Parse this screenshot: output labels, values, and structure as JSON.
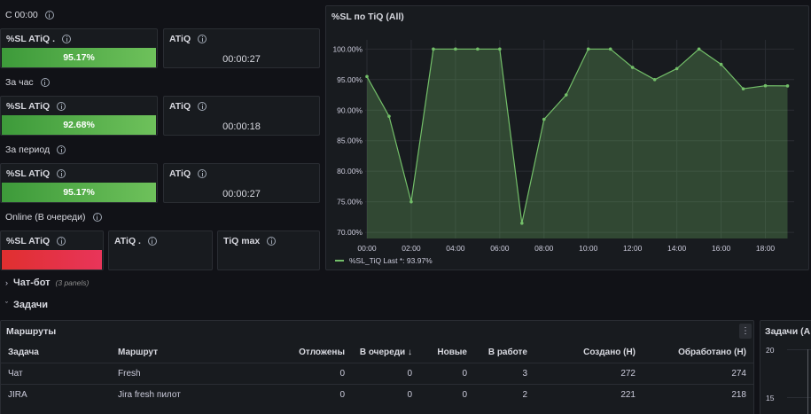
{
  "top": {
    "title_since": "С 00:00",
    "sl1": {
      "title": "%SL ATiQ .",
      "value": "95.17%"
    },
    "atiq1": {
      "title": "ATiQ",
      "value": "00:00:27"
    },
    "title_hour": "За час",
    "sl2": {
      "title": "%SL ATiQ",
      "value": "92.68%"
    },
    "atiq2": {
      "title": "ATiQ",
      "value": "00:00:18"
    },
    "title_period": "За период",
    "sl3": {
      "title": "%SL ATiQ",
      "value": "95.17%"
    },
    "atiq3": {
      "title": "ATiQ",
      "value": "00:00:27"
    },
    "title_online": "Online (В очереди)",
    "online_sl": {
      "title": "%SL ATiQ"
    },
    "online_atiq": {
      "title": "ATiQ ."
    },
    "online_tiq": {
      "title": "TiQ max"
    }
  },
  "colors": {
    "green": "#73bf69",
    "red": "#e02f44",
    "bg": "#111217",
    "panel": "#181b1f"
  },
  "chart_panel": {
    "title": "%SL по TiQ (All)",
    "legend": "%SL_TiQ  Last *: 93.97%"
  },
  "chart_data": {
    "type": "area",
    "title": "%SL по TiQ (All)",
    "x_ticks": [
      "00:00",
      "02:00",
      "04:00",
      "06:00",
      "08:00",
      "10:00",
      "12:00",
      "14:00",
      "16:00",
      "18:00"
    ],
    "y_ticks": [
      "70.00%",
      "75.00%",
      "80.00%",
      "85.00%",
      "90.00%",
      "95.00%",
      "100.00%"
    ],
    "ylim": [
      69,
      101.5
    ],
    "xlim": [
      0,
      19.3
    ],
    "series": [
      {
        "name": "%SL_TiQ",
        "color": "#73bf69",
        "x": [
          0,
          1,
          2,
          3,
          4,
          5,
          6,
          7,
          8,
          9,
          10,
          11,
          12,
          13,
          14,
          15,
          16,
          17,
          18,
          19
        ],
        "y": [
          95.5,
          89,
          75,
          100,
          100,
          100,
          100,
          71.5,
          88.5,
          92.5,
          100,
          100,
          97,
          95,
          96.8,
          100,
          97.5,
          93.5,
          94,
          93.97
        ]
      }
    ]
  },
  "sections": {
    "chatbot": {
      "label": "Чат-бот",
      "sub": "(3 panels)"
    },
    "tasks": {
      "label": "Задачи"
    }
  },
  "routes": {
    "title": "Маршруты",
    "columns": [
      "Задача",
      "Маршрут",
      "Отложены",
      "В очереди",
      "Новые",
      "В работе",
      "Создано (Н)",
      "Обработано (Н)"
    ],
    "sort_arrow": "↓",
    "rows": [
      [
        "Чат",
        "Fresh",
        "0",
        "0",
        "0",
        "3",
        "272",
        "274"
      ],
      [
        "JIRA",
        "Jira fresh пилот",
        "0",
        "0",
        "0",
        "2",
        "221",
        "218"
      ]
    ],
    "menu": "⋮"
  },
  "side_panel": {
    "title": "Задачи (All",
    "y1": "20",
    "y2": "15"
  }
}
